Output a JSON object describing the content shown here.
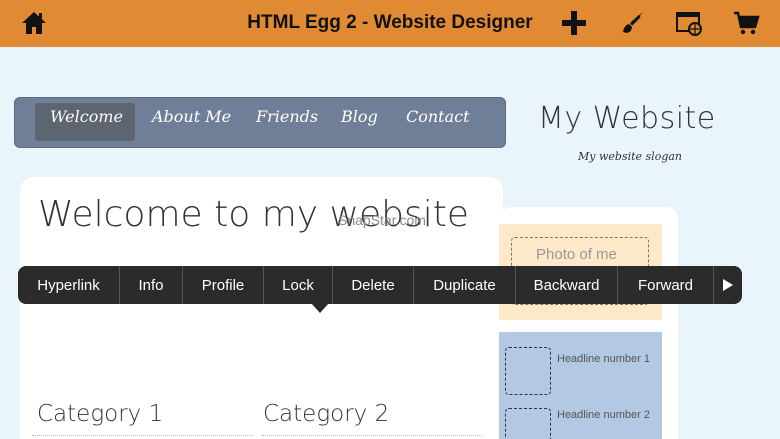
{
  "app": {
    "title": "HTML Egg 2 - Website Designer"
  },
  "toolbar": {
    "home_icon": "home-icon",
    "add_icon": "plus-icon",
    "brush_icon": "brush-icon",
    "browser_icon": "browser-globe-icon",
    "cart_icon": "cart-icon"
  },
  "site": {
    "nav": [
      "Welcome",
      "About Me",
      "Friends",
      "Blog",
      "Contact"
    ],
    "nav_selected": "Welcome",
    "title": "My Website",
    "slogan": "My website slogan",
    "heading": "Welcome to my website",
    "watermark": "SnapStar.com",
    "photo_label": "Photo of me",
    "headlines": [
      "Headline number 1",
      "Headline number 2"
    ],
    "categories": [
      "Category 1",
      "Category 2"
    ]
  },
  "context_menu": {
    "items": [
      "Hyperlink",
      "Info",
      "Profile",
      "Lock",
      "Delete",
      "Duplicate",
      "Backward",
      "Forward"
    ],
    "more_icon": "play-right-icon"
  },
  "colors": {
    "topbar": "#e08a33",
    "nav": "#6f7f97",
    "photo_bg": "#fde9c9",
    "headlines_bg": "#b3c8e2"
  }
}
